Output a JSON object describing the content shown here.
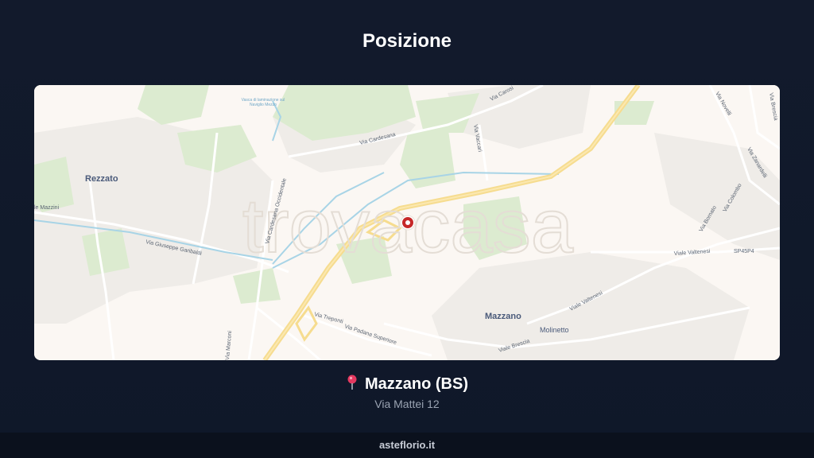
{
  "header": {
    "title": "Posizione"
  },
  "map": {
    "watermark": "trovacasa",
    "places": {
      "rezzato": "Rezzato",
      "mazzano": "Mazzano",
      "molinetto": "Molinetto"
    },
    "roads": {
      "via_mazzini": "le Mazzini",
      "via_garibaldi": "Via Giuseppe Garibaldi",
      "via_cardesana": "Via Cardesana",
      "via_cardesana_occ": "Via Cardesana Occidentale",
      "via_caroso": "Via Carosi",
      "via_vaccari": "Via Vaccari",
      "via_treponti": "Via Treponti",
      "via_padana": "Via Padana Superiore",
      "via_brescia": "Viale Brescia",
      "viale_valtenesi": "Viale Valtenesi",
      "viale_valtenesi_2": "Viale Valtenesi",
      "sp": "SP45P4",
      "via_bornato": "Via Bornato",
      "via_marconi": "Via Marconi",
      "via_n1": "Via Novelli",
      "via_n2": "Via Brescia",
      "via_n3": "Via Zanardelli",
      "via_n4": "Via Colombo"
    },
    "poi": "Vasca di laminazione sul Naviglio Mezzo",
    "marker_icon": "location-marker-icon"
  },
  "location": {
    "pin_icon": "pushpin-icon",
    "name": "Mazzano (BS)",
    "address": "Via Mattei 12"
  },
  "footer": {
    "site": "asteflorio.it"
  },
  "colors": {
    "background": "#121a2c",
    "map_base": "#fbf7f3",
    "green_area": "#dcebd0",
    "highway": "#f6dc8f",
    "marker": "#c62828"
  }
}
